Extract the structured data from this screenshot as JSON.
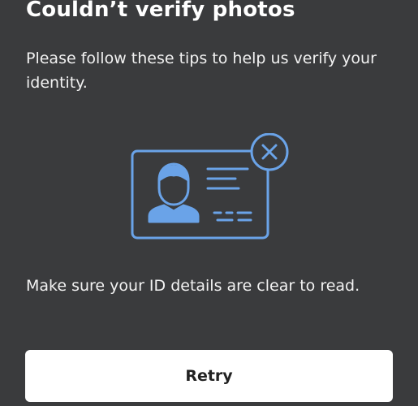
{
  "dialog": {
    "title": "Couldn’t verify photos",
    "subtitle": "Please follow these tips to help us verify your identity.",
    "illustration_icon": "id-card-error-icon",
    "hint": "Make sure your ID details are clear to read.",
    "retry_label": "Retry"
  },
  "colors": {
    "background": "#3a3b3d",
    "accent": "#6aa3e8",
    "button_bg": "#ffffff",
    "button_text": "#222222"
  }
}
